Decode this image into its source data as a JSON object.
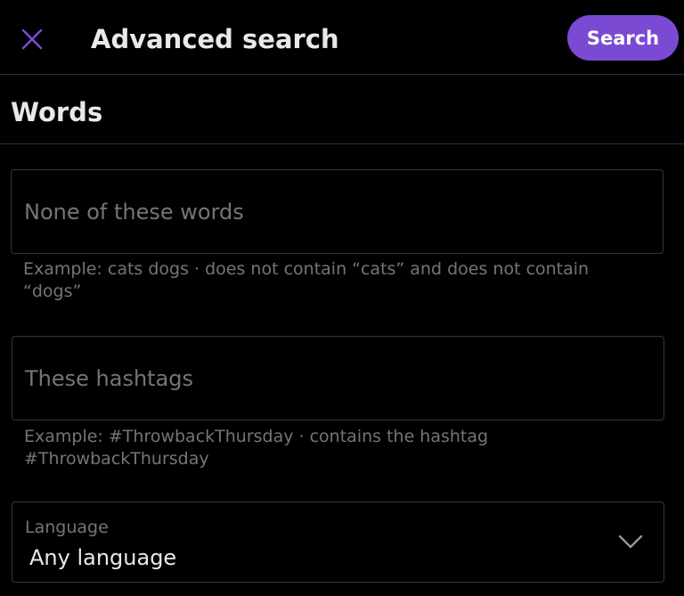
{
  "header": {
    "title": "Advanced search",
    "close_icon": "close-icon",
    "search_label": "Search",
    "accent_color": "#7b4ad3"
  },
  "section": {
    "title": "Words"
  },
  "fields": {
    "none_of_these_words": {
      "value": "",
      "placeholder": "None of these words",
      "helper": "Example: cats dogs · does not contain “cats” and does not contain “dogs”"
    },
    "hashtags": {
      "value": "",
      "placeholder": "These hashtags",
      "helper": "Example: #ThrowbackThursday · contains the hashtag #ThrowbackThursday"
    }
  },
  "language": {
    "label": "Language",
    "selected": "Any language",
    "icon": "chevron-down-icon"
  }
}
